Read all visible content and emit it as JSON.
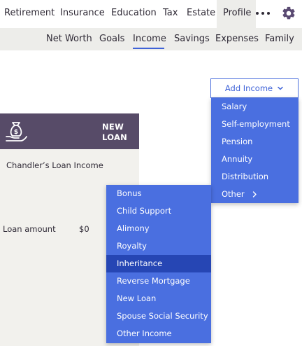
{
  "top_nav": {
    "items": [
      {
        "label": "Retirement",
        "active": false
      },
      {
        "label": "Insurance",
        "active": false
      },
      {
        "label": "Education",
        "active": false
      },
      {
        "label": "Tax",
        "active": false
      },
      {
        "label": "Estate",
        "active": false
      },
      {
        "label": "Profile",
        "active": true
      }
    ],
    "more_icon": "more-horizontal-icon",
    "settings_icon": "gear-icon"
  },
  "sub_nav": {
    "items": [
      {
        "label": "Net Worth",
        "active": false
      },
      {
        "label": "Goals",
        "active": false
      },
      {
        "label": "Income",
        "active": true
      },
      {
        "label": "Savings",
        "active": false
      },
      {
        "label": "Expenses",
        "active": false
      },
      {
        "label": "Family",
        "active": false
      }
    ]
  },
  "add_income": {
    "label": "Add Income",
    "icon": "chevron-down-icon",
    "menu": [
      "Salary",
      "Self-employment",
      "Pension",
      "Annuity",
      "Distribution",
      "Other"
    ],
    "submenu_arrow_icon": "chevron-right-icon"
  },
  "other_submenu": {
    "items": [
      "Bonus",
      "Child Support",
      "Alimony",
      "Royalty",
      "Inheritance",
      "Reverse Mortgage",
      "New Loan",
      "Spouse Social Security",
      "Other Income"
    ],
    "highlighted": "Inheritance"
  },
  "loan_card": {
    "icon": "money-bag-hand-icon",
    "badge_line1": "NEW",
    "badge_line2": "LOAN",
    "title": "Chandler’s Loan Income",
    "amount_label": "Loan amount",
    "amount_value": "$0"
  },
  "colors": {
    "accent": "#3f63d8",
    "menu_bg": "#4a6fe0",
    "menu_highlight": "#2646b4",
    "card_header": "#574b68",
    "nav_bg": "#ededea"
  }
}
